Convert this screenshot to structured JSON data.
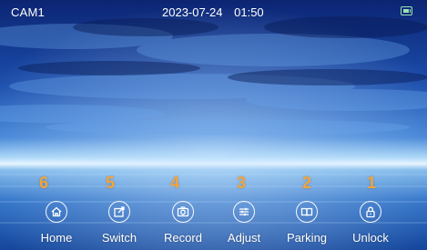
{
  "header": {
    "camera": "CAM1",
    "date": "2023-07-24",
    "time": "01:50",
    "storage_icon": "sd-card-icon",
    "storage_color": "#9be2b3"
  },
  "accent_color": "#f3a43c",
  "controls": [
    {
      "number": "6",
      "label": "Home",
      "icon": "home-icon"
    },
    {
      "number": "5",
      "label": "Switch",
      "icon": "switch-icon"
    },
    {
      "number": "4",
      "label": "Record",
      "icon": "camera-icon"
    },
    {
      "number": "3",
      "label": "Adjust",
      "icon": "sliders-icon"
    },
    {
      "number": "2",
      "label": "Parking",
      "icon": "book-icon"
    },
    {
      "number": "1",
      "label": "Unlock",
      "icon": "padlock-icon"
    }
  ]
}
